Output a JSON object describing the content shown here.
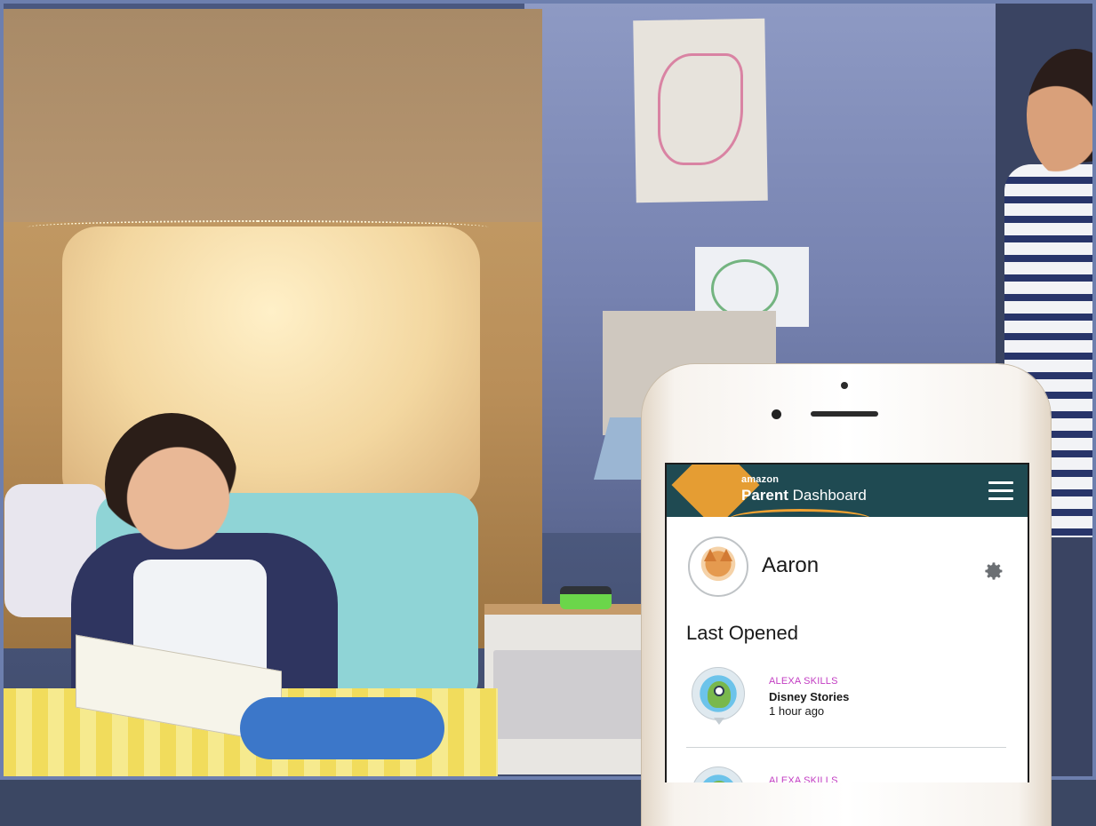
{
  "app": {
    "brand_small": "amazon",
    "brand_strong": "Parent",
    "brand_rest": " Dashboard",
    "accent_color": "#1f4a52",
    "kite_color": "#f0a131"
  },
  "profile": {
    "name": "Aaron"
  },
  "section": {
    "title": "Last Opened"
  },
  "activity": [
    {
      "category": "ALEXA SKILLS",
      "title": "Disney Stories",
      "time": "1 hour ago",
      "icon": "disney-stories-icon"
    },
    {
      "category": "ALEXA SKILLS",
      "icon": "alexa-skill-icon"
    }
  ],
  "icons": {
    "menu": "hamburger-menu-icon",
    "settings": "gear-icon"
  },
  "category_color": "#c23cc2"
}
